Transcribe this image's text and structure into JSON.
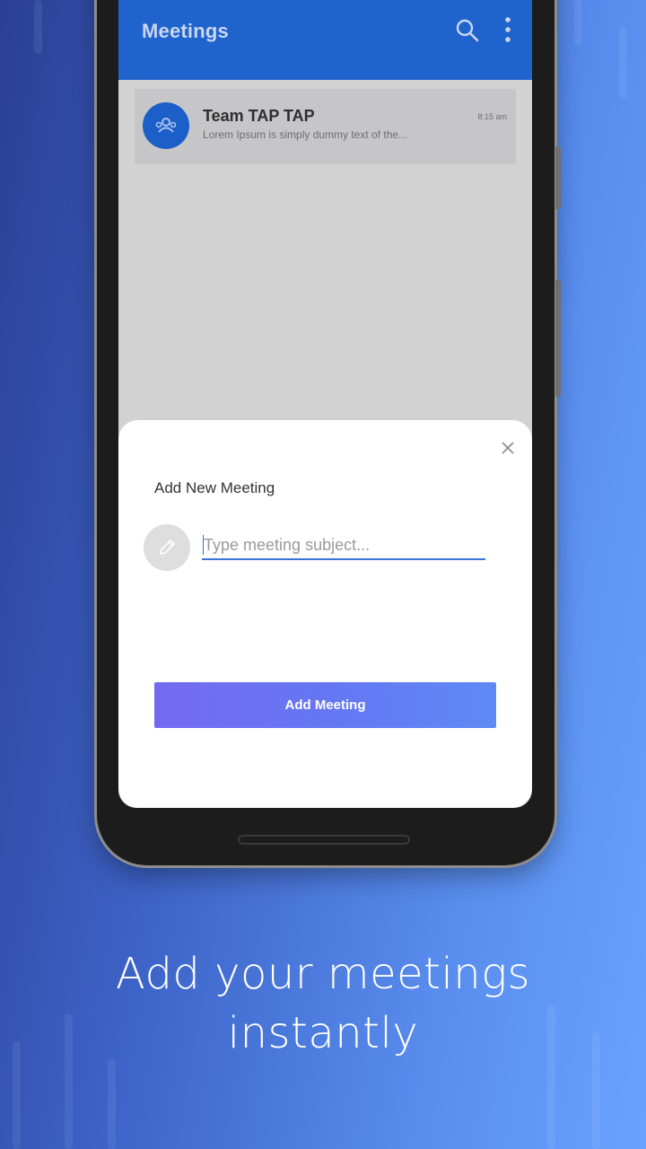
{
  "app": {
    "title": "Meetings"
  },
  "chat_list": [
    {
      "name": "Team TAP TAP",
      "preview": "Lorem Ipsum is simply dummy text of the...",
      "time": "8:15 am"
    }
  ],
  "dialog": {
    "title": "Add New Meeting",
    "input_placeholder": "Type meeting subject...",
    "input_value": "",
    "submit_label": "Add Meeting"
  },
  "caption": {
    "line1": "Add your meetings",
    "line2": "instantly"
  },
  "colors": {
    "appbar": "#1f63cc",
    "button_start": "#746af2",
    "button_end": "#5f8af5",
    "background_start": "#2b3f93",
    "background_end": "#6aa2ff"
  },
  "icons": [
    "search-icon",
    "more-vert-icon",
    "group-icon",
    "close-icon",
    "pencil-icon"
  ]
}
